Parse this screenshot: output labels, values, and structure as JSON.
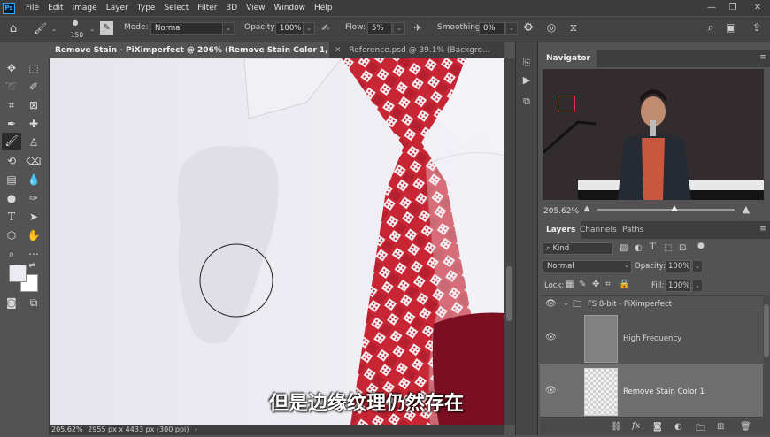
{
  "menubar": {
    "logo": "Ps",
    "items": [
      "File",
      "Edit",
      "Image",
      "Layer",
      "Type",
      "Select",
      "Filter",
      "3D",
      "View",
      "Window",
      "Help"
    ]
  },
  "options": {
    "brush_size": "150",
    "mode_label": "Mode:",
    "mode_value": "Normal",
    "opacity_label": "Opacity:",
    "opacity_value": "100%",
    "flow_label": "Flow:",
    "flow_value": "5%",
    "smoothing_label": "Smoothing:",
    "smoothing_value": "0%"
  },
  "tabs": [
    {
      "label": "Remove Stain - PiXimperfect @ 206% (Remove Stain Color 1, RGB/8) *",
      "active": true
    },
    {
      "label": "Reference.psd @ 39.1% (Backgro...",
      "active": false
    }
  ],
  "subtitle": "但是边缘纹理仍然存在",
  "status": {
    "zoom": "205.62%",
    "doc_info": "2955 px x 4433 px (300 ppi)"
  },
  "navigator": {
    "title": "Navigator",
    "zoom": "205.62%"
  },
  "layers": {
    "tabs": [
      "Layers",
      "Channels",
      "Paths"
    ],
    "kind_label": "Kind",
    "blend_mode": "Normal",
    "opacity_label": "Opacity:",
    "opacity_value": "100%",
    "lock_label": "Lock:",
    "fill_label": "Fill:",
    "fill_value": "100%",
    "group_name": "FS 8-bit - PiXimperfect",
    "items": [
      {
        "name": "High Frequency"
      },
      {
        "name": "Remove Stain Color 1"
      }
    ]
  },
  "colors": {
    "app_bg": "#535353",
    "panel_dark": "#3c3c3c",
    "selected_layer": "#6e6e6e",
    "tie_red": "#d8343c",
    "shirt": "#e9e8ef"
  }
}
